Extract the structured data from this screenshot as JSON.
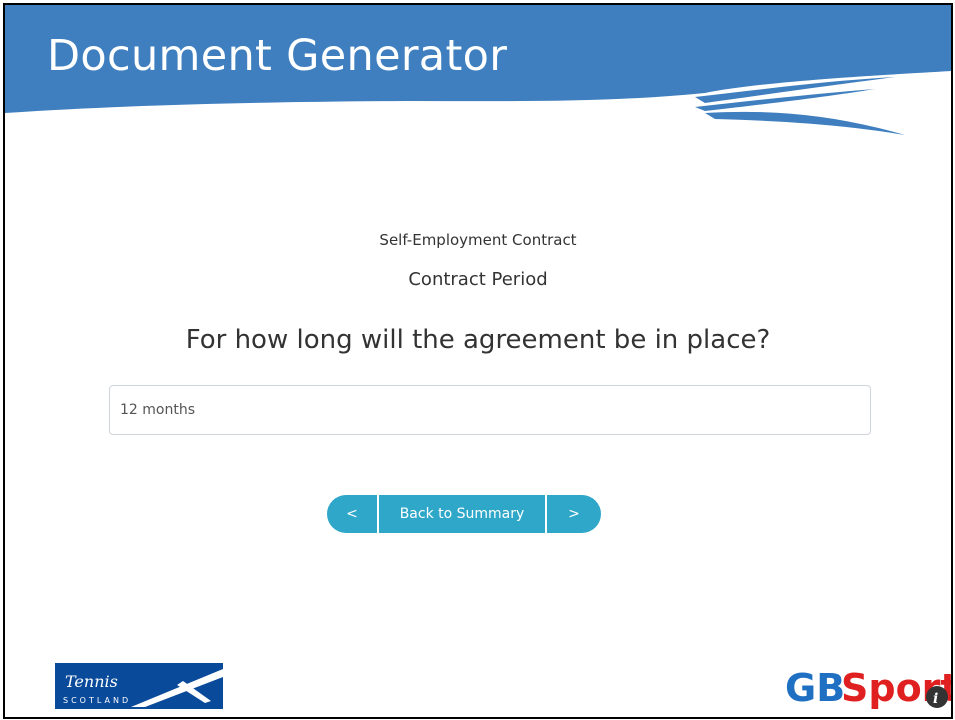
{
  "header": {
    "title": "Document Generator"
  },
  "form": {
    "document_type": "Self-Employment Contract",
    "section": "Contract Period",
    "question": "For how long will the agreement be in place?",
    "answer_value": "12 months"
  },
  "navigation": {
    "prev_label": "<",
    "summary_label": "Back to Summary",
    "next_label": ">"
  },
  "footer": {
    "left_logo": {
      "line1": "Tennis",
      "line2": "SCOTLAND"
    },
    "right_logo": {
      "part1": "GB",
      "part2": "Sport"
    }
  },
  "colors": {
    "banner": "#3f7fbf",
    "button": "#2ea7c9",
    "gb_blue": "#1f6fc2",
    "sport_red": "#e02020"
  }
}
